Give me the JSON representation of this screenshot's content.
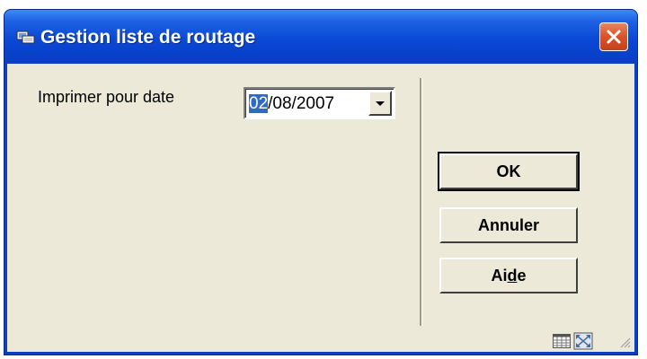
{
  "window": {
    "title": "Gestion liste de routage"
  },
  "form": {
    "print_date_label": "Imprimer pour date",
    "date_selected_part": "02",
    "date_rest": "/08/2007"
  },
  "buttons": {
    "ok": "OK",
    "annuler": "Annuler",
    "aide_pre": "Ai",
    "aide_mnemonic": "d",
    "aide_post": "e"
  },
  "icons": {
    "title": "app-icon",
    "close": "close-icon",
    "dropdown": "chevron-down-icon",
    "status_grid": "calendar-grid-icon",
    "status_max": "maximize-icon",
    "grip": "resize-grip-icon"
  },
  "colors": {
    "title_bar": "#0a48d6",
    "close_button": "#d8532a",
    "client_bg": "#ece9d8",
    "selection": "#316ac5"
  }
}
